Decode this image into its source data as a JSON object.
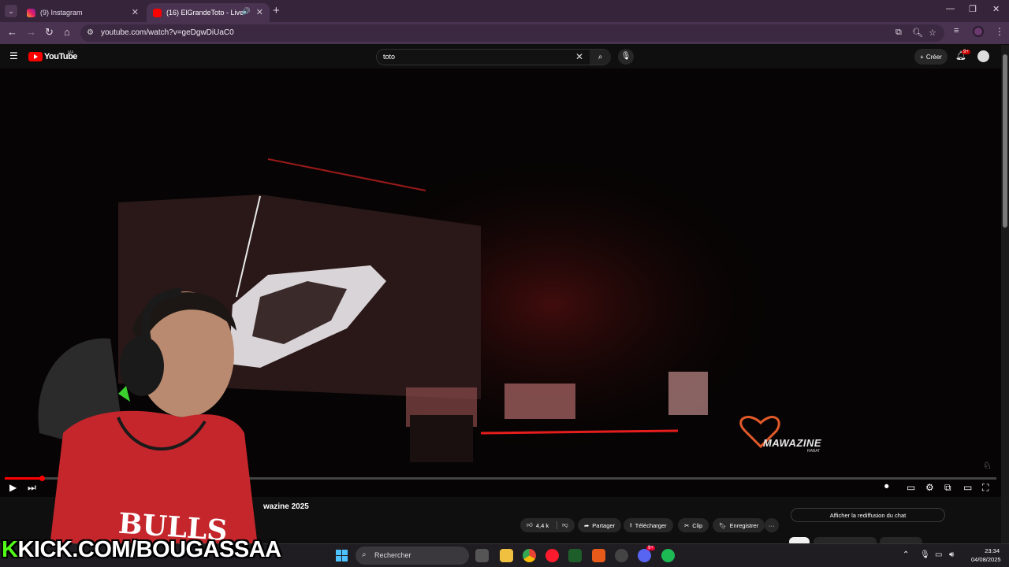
{
  "browser": {
    "tabs": [
      {
        "label": "(9) Instagram",
        "active": false
      },
      {
        "label": "(16) ElGrandeToto - Live fro",
        "active": true
      }
    ],
    "new_tab": "+",
    "url": "youtube.com/watch?v=geDgwDiUaC0"
  },
  "youtube": {
    "logo": "YouTube",
    "region": "MA",
    "search_value": "toto",
    "create_label": "Créer",
    "notif_count": "9+"
  },
  "video": {
    "watermark": "MAWAZINE",
    "watermark_sub": "RABAT",
    "progress_fraction": 0.037,
    "title": "wazine 2025"
  },
  "actions": {
    "likes": "4,4 k",
    "share": "Partager",
    "download": "Télécharger",
    "clip": "Clip",
    "save": "Enregistrer",
    "more": "···",
    "chat_replay": "Afficher la rediffusion du chat"
  },
  "taskbar": {
    "search_placeholder": "Rechercher",
    "time": "23:34",
    "date": "04/08/2025",
    "discord_badge": "9+"
  },
  "overlay": {
    "kick_k": "K",
    "kick_text": "KICK.COM/BOUGASSAA"
  },
  "colors": {
    "tab_bar": "#35243a",
    "address_bar": "#4a3350",
    "yt_red": "#ff0000",
    "kick_green": "#53fc18"
  }
}
